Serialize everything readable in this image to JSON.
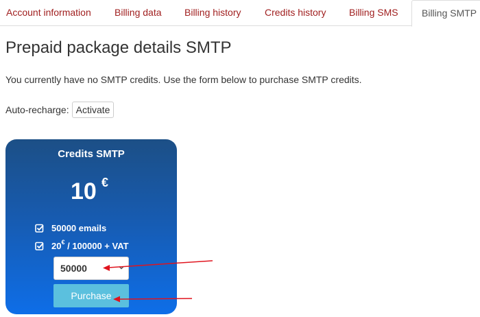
{
  "tabs": [
    {
      "label": "Account information"
    },
    {
      "label": "Billing data"
    },
    {
      "label": "Billing history"
    },
    {
      "label": "Credits history"
    },
    {
      "label": "Billing SMS"
    },
    {
      "label": "Billing SMTP",
      "active": true
    }
  ],
  "page": {
    "title": "Prepaid package details SMTP",
    "info_text": "You currently have no SMTP credits. Use the form below to purchase SMTP credits.",
    "auto_recharge_label": "Auto-recharge:",
    "activate_label": "Activate"
  },
  "card": {
    "title": "Credits SMTP",
    "price_amount": "10",
    "price_currency": "€",
    "features": [
      {
        "text": "50000 emails"
      },
      {
        "prefix": "20",
        "currency": "€",
        "text": " / 100000 + VAT"
      }
    ],
    "quantity_selected": "50000",
    "purchase_label": "Purchase",
    "colors": {
      "top": "#1c4f86",
      "bottom": "#0e6ee8",
      "button": "#5bc0de"
    }
  },
  "annotations": {
    "arrow_color": "#e0141e"
  }
}
